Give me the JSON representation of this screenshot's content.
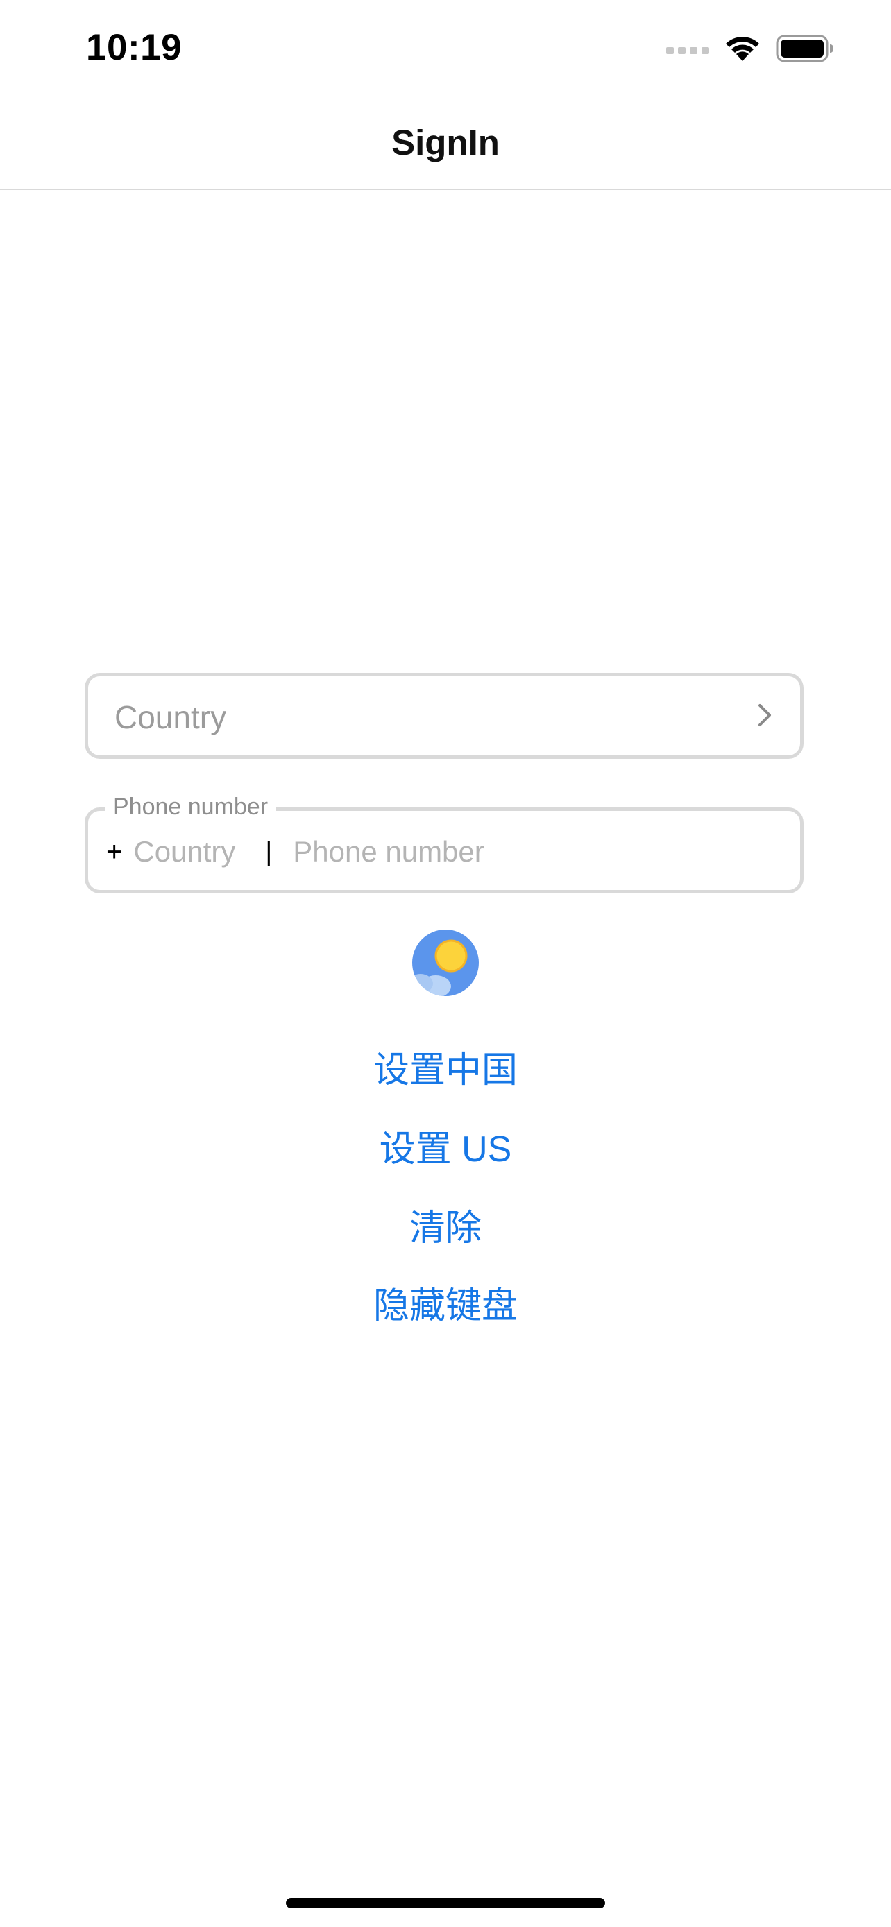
{
  "status_bar": {
    "time": "10:19",
    "icons": [
      "signal-icon",
      "wifi-icon",
      "battery-icon"
    ]
  },
  "nav": {
    "title": "SignIn"
  },
  "country_field": {
    "placeholder": "Country",
    "icon": "chevron-right-icon"
  },
  "phone_field": {
    "label": "Phone number",
    "prefix": "+",
    "code_placeholder": "Country",
    "separator": "|",
    "placeholder": "Phone number"
  },
  "image": {
    "icon": "image-placeholder-icon"
  },
  "actions": {
    "set_china": "设置中国",
    "set_us": "设置 US",
    "clear": "清除",
    "hide_keyboard": "隐藏键盘"
  },
  "colors": {
    "accent": "#1677e6",
    "border": "#d9d9d9",
    "placeholder": "#9b9b9b"
  }
}
